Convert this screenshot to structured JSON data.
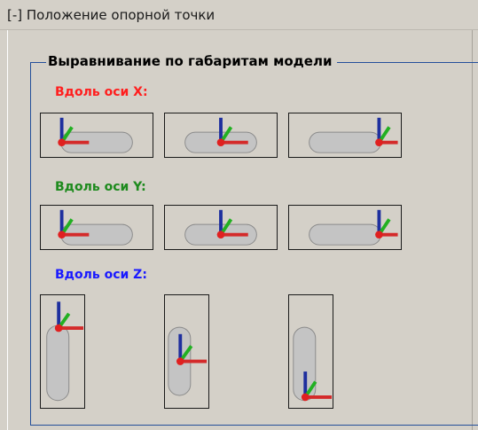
{
  "header": {
    "title": "[-] Положение опорной точки"
  },
  "group": {
    "title": "Выравнивание по габаритам модели"
  },
  "sections": [
    {
      "label": "Вдоль оси X:",
      "color": "#ff1e1e"
    },
    {
      "label": "Вдоль оси Y:",
      "color": "#1d8a1d"
    },
    {
      "label": "Вдоль оси Z:",
      "color": "#1a1aff"
    }
  ],
  "colors": {
    "x_axis": "#d42a2a",
    "y_axis": "#22b022",
    "z_axis": "#1e2f9e",
    "pivot": "#e02020",
    "capsule_fill": "#c4c4c4",
    "capsule_stroke": "#8a8a8a"
  }
}
